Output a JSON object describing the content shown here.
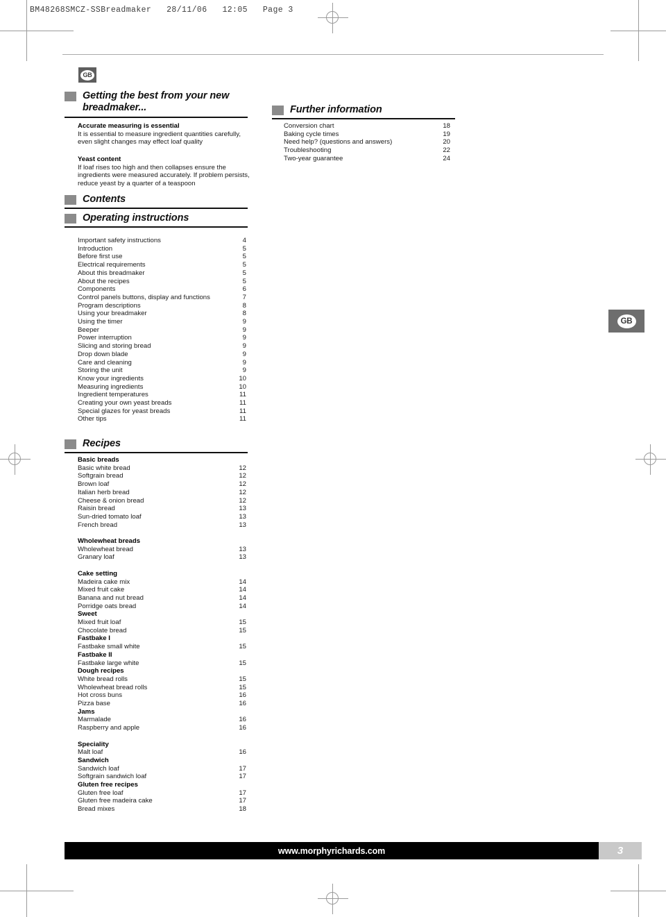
{
  "print_slug": "BM48268SMCZ-SSBreadmaker   28/11/06   12:05   Page 3",
  "locale_badge": "GB",
  "side_tab": "GB",
  "intro": {
    "heading": "Getting the best from your new breadmaker...",
    "blocks": [
      {
        "subhead": "Accurate measuring is essential",
        "text": "It is essential to measure ingredient quantities carefully, even slight changes may effect loaf quality"
      },
      {
        "subhead": "Yeast content",
        "text": "If loaf rises too high and then collapses ensure the ingredients were measured accurately. If problem persists, reduce yeast by a quarter of a teaspoon"
      }
    ]
  },
  "further_information": {
    "heading": "Further information",
    "entries": [
      {
        "label": "Conversion chart",
        "page": "18"
      },
      {
        "label": "Baking cycle times",
        "page": "19"
      },
      {
        "label": "Need help? (questions and answers)",
        "page": "20"
      },
      {
        "label": "Troubleshooting",
        "page": "22"
      },
      {
        "label": "Two-year guarantee",
        "page": "24"
      }
    ]
  },
  "contents_heading": "Contents",
  "operating_instructions": {
    "heading": "Operating instructions",
    "entries": [
      {
        "label": "Important safety instructions",
        "page": "4"
      },
      {
        "label": "Introduction",
        "page": "5"
      },
      {
        "label": "Before first use",
        "page": "5"
      },
      {
        "label": "Electrical requirements",
        "page": "5"
      },
      {
        "label": "About this breadmaker",
        "page": "5"
      },
      {
        "label": "About the recipes",
        "page": "5"
      },
      {
        "label": "Components",
        "page": "6"
      },
      {
        "label": "Control panels buttons, display and functions",
        "page": "7"
      },
      {
        "label": "Program descriptions",
        "page": "8"
      },
      {
        "label": "Using your breadmaker",
        "page": "8"
      },
      {
        "label": "Using the timer",
        "page": "9"
      },
      {
        "label": "Beeper",
        "page": "9"
      },
      {
        "label": "Power interruption",
        "page": "9"
      },
      {
        "label": "Slicing and storing bread",
        "page": "9"
      },
      {
        "label": "Drop down blade",
        "page": "9"
      },
      {
        "label": "Care and cleaning",
        "page": "9"
      },
      {
        "label": "Storing the unit",
        "page": "9"
      },
      {
        "label": "Know your ingredients",
        "page": "10"
      },
      {
        "label": "Measuring ingredients",
        "page": "10"
      },
      {
        "label": "Ingredient temperatures",
        "page": "11"
      },
      {
        "label": "Creating your own yeast breads",
        "page": "11"
      },
      {
        "label": "Special glazes for yeast breads",
        "page": "11"
      },
      {
        "label": "Other tips",
        "page": "11"
      }
    ]
  },
  "recipes": {
    "heading": "Recipes",
    "entries": [
      {
        "label": "Basic breads",
        "page": "",
        "group": true
      },
      {
        "label": "Basic white bread",
        "page": "12",
        "group": false
      },
      {
        "label": "Softgrain bread",
        "page": "12",
        "group": false
      },
      {
        "label": "Brown loaf",
        "page": "12",
        "group": false
      },
      {
        "label": "Italian herb bread",
        "page": "12",
        "group": false
      },
      {
        "label": "Cheese & onion bread",
        "page": "12",
        "group": false
      },
      {
        "label": "Raisin bread",
        "page": "13",
        "group": false
      },
      {
        "label": "Sun-dried tomato loaf",
        "page": "13",
        "group": false
      },
      {
        "label": "French bread",
        "page": "13",
        "group": false
      },
      {
        "label": "",
        "page": "",
        "spacer": true
      },
      {
        "label": "Wholewheat breads",
        "page": "",
        "group": true
      },
      {
        "label": "Wholewheat bread",
        "page": "13",
        "group": false
      },
      {
        "label": "Granary loaf",
        "page": "13",
        "group": false
      },
      {
        "label": "",
        "page": "",
        "spacer": true
      },
      {
        "label": "Cake setting",
        "page": "",
        "group": true
      },
      {
        "label": "Madeira cake mix",
        "page": "14",
        "group": false
      },
      {
        "label": "Mixed fruit cake",
        "page": "14",
        "group": false
      },
      {
        "label": "Banana and nut bread",
        "page": "14",
        "group": false
      },
      {
        "label": "Porridge oats bread",
        "page": "14",
        "group": false
      },
      {
        "label": "Sweet",
        "page": "",
        "group": true
      },
      {
        "label": "Mixed fruit loaf",
        "page": "15",
        "group": false
      },
      {
        "label": "Chocolate bread",
        "page": "15",
        "group": false
      },
      {
        "label": "Fastbake I",
        "page": "",
        "group": true
      },
      {
        "label": "Fastbake small white",
        "page": "15",
        "group": false
      },
      {
        "label": "Fastbake II",
        "page": "",
        "group": true
      },
      {
        "label": "Fastbake large white",
        "page": "15",
        "group": false
      },
      {
        "label": "Dough recipes",
        "page": "",
        "group": true
      },
      {
        "label": "White bread rolls",
        "page": "15",
        "group": false
      },
      {
        "label": "Wholewheat bread rolls",
        "page": "15",
        "group": false
      },
      {
        "label": "Hot cross buns",
        "page": "16",
        "group": false
      },
      {
        "label": "Pizza base",
        "page": "16",
        "group": false
      },
      {
        "label": "Jams",
        "page": "",
        "group": true
      },
      {
        "label": "Marmalade",
        "page": "16",
        "group": false
      },
      {
        "label": "Raspberry and apple",
        "page": "16",
        "group": false
      },
      {
        "label": "",
        "page": "",
        "spacer": true
      },
      {
        "label": "Speciality",
        "page": "",
        "group": true
      },
      {
        "label": "Malt loaf",
        "page": "16",
        "group": false
      },
      {
        "label": "Sandwich",
        "page": "",
        "group": true
      },
      {
        "label": "Sandwich loaf",
        "page": "17",
        "group": false
      },
      {
        "label": "Softgrain sandwich loaf",
        "page": "17",
        "group": false
      },
      {
        "label": "Gluten free recipes",
        "page": "",
        "group": true
      },
      {
        "label": "Gluten free loaf",
        "page": "17",
        "group": false
      },
      {
        "label": "Gluten free madeira cake",
        "page": "17",
        "group": false
      },
      {
        "label": "Bread mixes",
        "page": "18",
        "group": false
      }
    ]
  },
  "footer": {
    "website": "www.morphyrichards.com",
    "page_number": "3"
  }
}
